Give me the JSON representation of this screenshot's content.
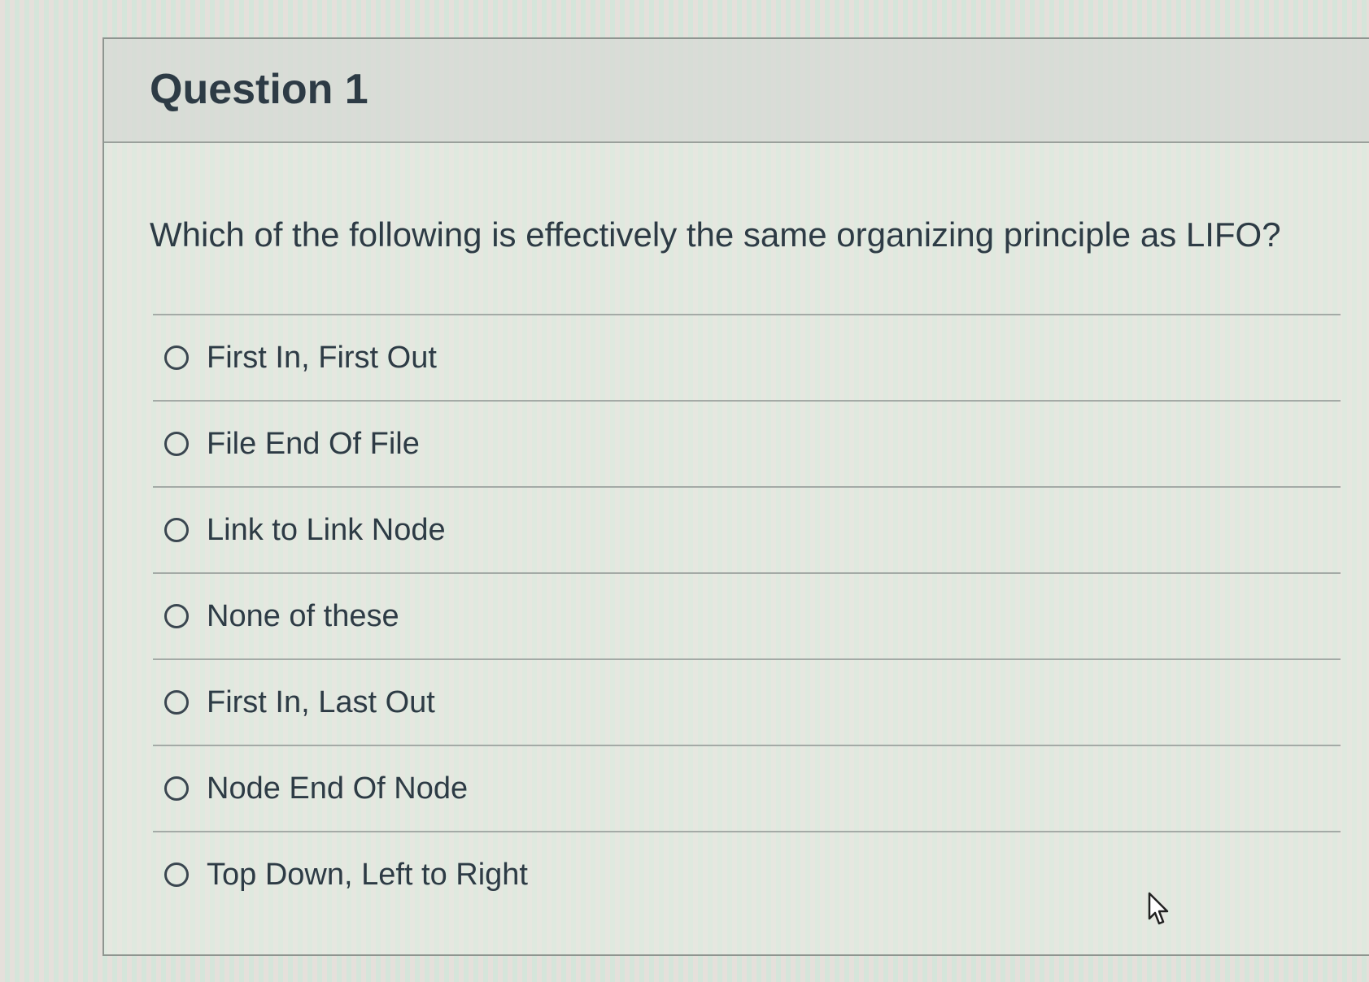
{
  "question": {
    "title": "Question 1",
    "text": "Which of the following is effectively the same organizing principle as LIFO?",
    "answers": [
      {
        "label": "First In, First Out"
      },
      {
        "label": "File End Of File"
      },
      {
        "label": "Link to Link Node"
      },
      {
        "label": "None of these"
      },
      {
        "label": "First In, Last Out"
      },
      {
        "label": "Node End Of Node"
      },
      {
        "label": "Top Down, Left to Right"
      }
    ]
  },
  "colors": {
    "text": "#2d3b45",
    "border": "#9aa09b",
    "background": "#dfe5db"
  },
  "icons": {
    "radio": "radio-unchecked-icon",
    "cursor": "mouse-pointer-icon"
  }
}
